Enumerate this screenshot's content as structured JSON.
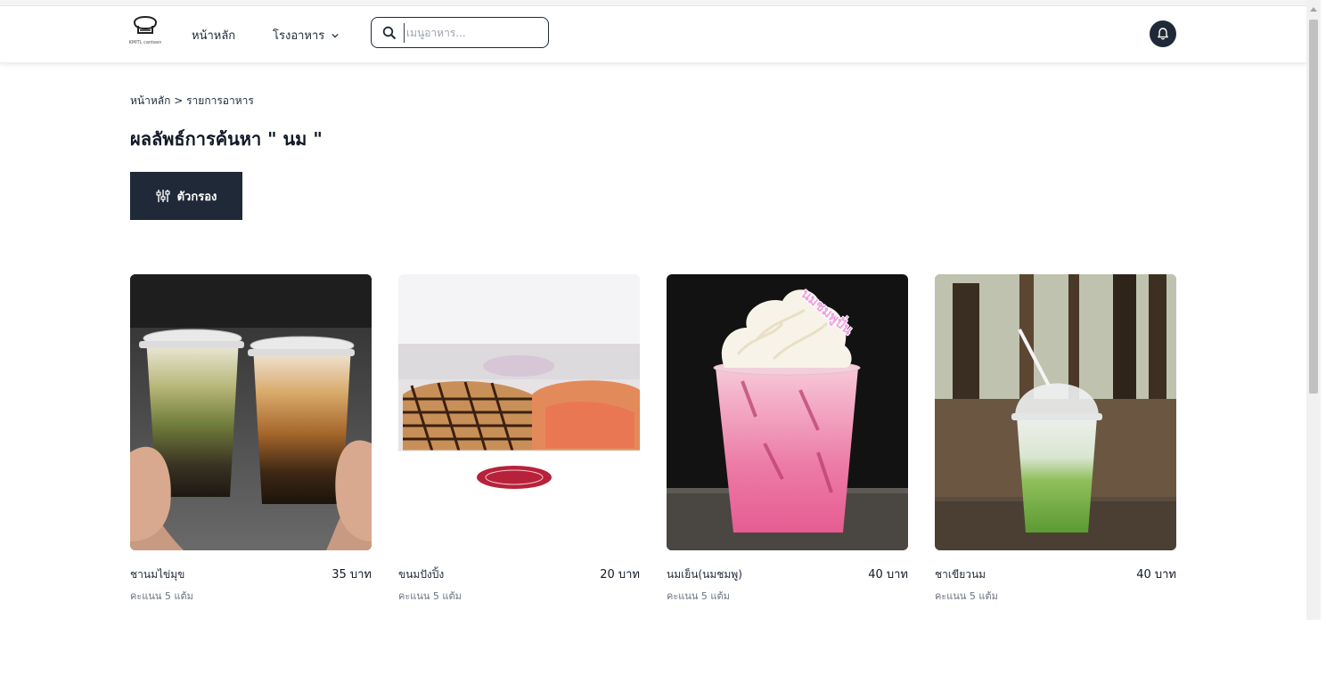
{
  "navbar": {
    "logo_text": "KMITL canteen",
    "home_label": "หน้าหลัก",
    "canteen_label": "โรงอาหาร",
    "search": {
      "placeholder": "เมนูอาหาร...",
      "value": ""
    }
  },
  "breadcrumb": {
    "home": "หน้าหลัก",
    "separator": ">",
    "current": "รายการอาหาร"
  },
  "page": {
    "title": "ผลลัพธ์การค้นหา \" นม \"",
    "filter_label": "ตัวกรอง"
  },
  "products": [
    {
      "name": "ชานมไข่มุข",
      "price": "35 บาท",
      "rating": "คะแนน 5 แต้ม"
    },
    {
      "name": "ขนมปังปิ้ง",
      "price": "20 บาท",
      "rating": "คะแนน 5 แต้ม"
    },
    {
      "name": "นมเย็น(นมชมพู)",
      "price": "40 บาท",
      "rating": "คะแนน 5 แต้ม",
      "overlay_text": "นมชมพูปั่น"
    },
    {
      "name": "ชาเขียวนม",
      "price": "40 บาท",
      "rating": "คะแนน 5 แต้ม"
    }
  ],
  "colors": {
    "primary_dark": "#1f2937",
    "text_muted": "#6b7280"
  },
  "icons": [
    "logo-icon",
    "chevron-down-icon",
    "search-icon",
    "bell-icon",
    "filter-sliders-icon"
  ]
}
